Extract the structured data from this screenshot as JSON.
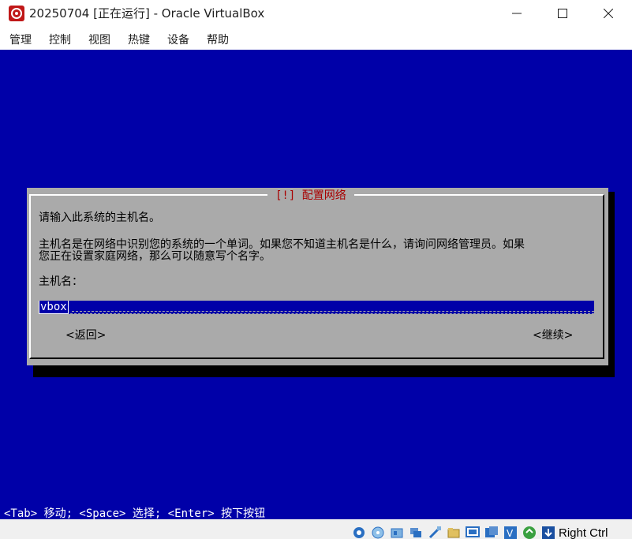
{
  "window": {
    "title": "20250704 [正在运行] - Oracle VirtualBox"
  },
  "menu": {
    "items": [
      "管理",
      "控制",
      "视图",
      "热键",
      "设备",
      "帮助"
    ]
  },
  "dialog": {
    "title": "[!] 配置网络",
    "prompt": "请输入此系统的主机名。",
    "description_line1": "主机名是在网络中识别您的系统的一个单词。如果您不知道主机名是什么，请询问网络管理员。如果",
    "description_line2": "您正在设置家庭网络，那么可以随意写个名字。",
    "field_label": "主机名：",
    "hostname_value": "vbox",
    "back_label": "<返回>",
    "continue_label": "<继续>"
  },
  "hint": "<Tab> 移动; <Space> 选择; <Enter> 按下按钮",
  "statusbar": {
    "host_key": "Right Ctrl",
    "icons": [
      "hard-disk-icon",
      "optical-drive-icon",
      "audio-icon",
      "network-icon",
      "usb-icon",
      "shared-folders-icon",
      "display-icon",
      "video-capture-icon",
      "virtualization-icon",
      "mouse-integration-icon",
      "keyboard-capture-icon"
    ]
  },
  "colors": {
    "vm_background": "#0000a8",
    "dialog_background": "#aaaaaa",
    "dialog_title": "#a80000"
  }
}
